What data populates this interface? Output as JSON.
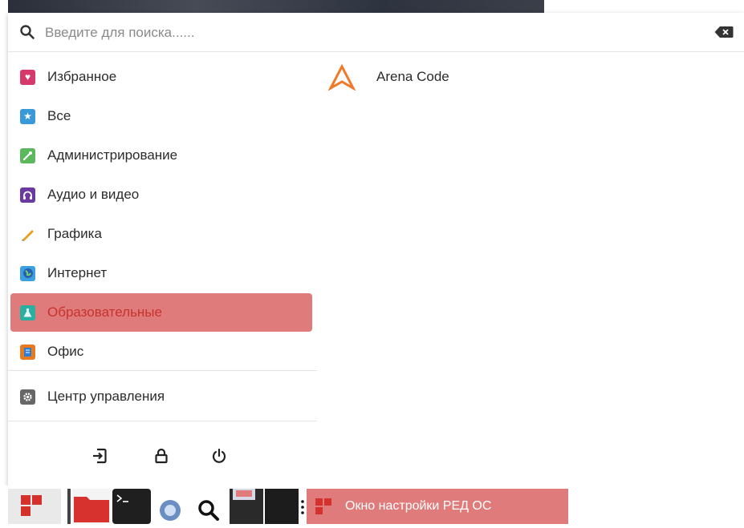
{
  "search": {
    "placeholder": "Введите для поиска......",
    "value": ""
  },
  "categories": [
    {
      "label": "Избранное",
      "icon": "heart-icon",
      "color": "#d63a6a"
    },
    {
      "label": "Все",
      "icon": "star-icon",
      "color": "#3a9ad9"
    },
    {
      "label": "Администрирование",
      "icon": "wrench-icon",
      "color": "#5cb85c"
    },
    {
      "label": "Аудио и видео",
      "icon": "headphones-icon",
      "color": "#6a3aa0"
    },
    {
      "label": "Графика",
      "icon": "pencil-icon",
      "color": "#e8a020"
    },
    {
      "label": "Интернет",
      "icon": "globe-icon",
      "color": "#2a7fd4"
    },
    {
      "label": "Образовательные",
      "icon": "flask-icon",
      "color": "#2ab0a0",
      "active": true
    },
    {
      "label": "Офис",
      "icon": "document-icon",
      "color": "#e87a20"
    }
  ],
  "control_center": {
    "label": "Центр управления",
    "icon": "gear-icon"
  },
  "bottom_actions": [
    "logout-icon",
    "lock-icon",
    "power-icon"
  ],
  "apps": [
    {
      "label": "Arena Code",
      "icon": "arena-code-icon",
      "color": "#f07a2a"
    }
  ],
  "taskbar": {
    "active_task_label": "Окно настройки РЕД ОС",
    "accent": "#e07b7b"
  }
}
